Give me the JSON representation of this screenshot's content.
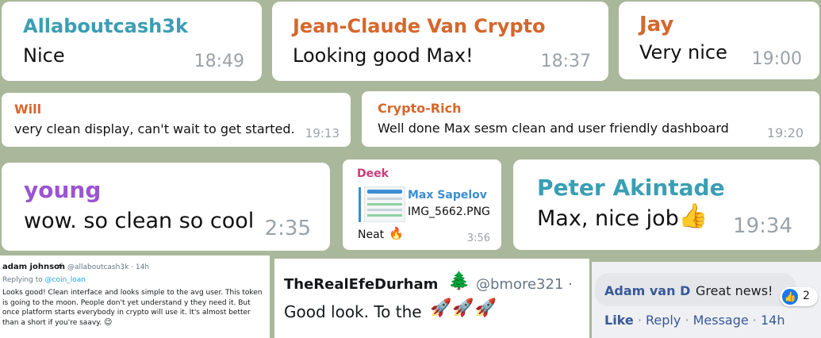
{
  "chat": {
    "messages": [
      {
        "sender": "Allaboutcash3k",
        "text": "Nice",
        "time": "18:49"
      },
      {
        "sender": "Jean-Claude Van Crypto",
        "text": "Looking good Max!",
        "time": "18:37"
      },
      {
        "sender": "Jay",
        "text": "Very nice",
        "time": "19:00"
      },
      {
        "sender": "Will",
        "text": "very clean display, can't wait to get started.",
        "time": "19:13"
      },
      {
        "sender": "Crypto-Rich",
        "text": "Well done Max sesm clean and user friendly dashboard",
        "time": "19:20"
      },
      {
        "sender": "young",
        "text": "wow. so clean so cool",
        "time": "2:35"
      },
      {
        "sender": "Deek",
        "forward_name": "Max Sapelov",
        "file": "IMG_5662.PNG",
        "text": "Neat",
        "time": "3:56"
      },
      {
        "sender": "Peter Akintade",
        "text": "Max, nice job",
        "time": "19:34"
      }
    ]
  },
  "tweet1": {
    "name": "adam johnson",
    "handle": "@allaboutcash3k · 14h",
    "reply_prefix": "Replying to ",
    "reply_to": "@coin_loan",
    "body": "Looks good! Clean interface and looks simple to the avg user.  This token is going to the moon. People don't yet understand y they need it. But once platform starts everybody in crypto will use it. It's almost better than a short if you're saavy."
  },
  "tweet2": {
    "name": "TheRealEfeDurham",
    "handle": "@bmore321 ·",
    "text": "Good look. To the"
  },
  "fb": {
    "name": "Adam van D",
    "text": "Great news!",
    "reactions": "2",
    "like": "Like",
    "sep1": " · ",
    "reply": "Reply",
    "sep2": " · ",
    "message": "Message",
    "sep3": " · ",
    "time": "14h"
  },
  "colors": {
    "background": "#a9b79a",
    "name_teal": "#3a9eb4",
    "name_orange": "#d6672c",
    "name_purple": "#9a55cf",
    "name_pink": "#c93c7a",
    "link_blue": "#3b8ed2",
    "fb_blue": "#385898"
  }
}
